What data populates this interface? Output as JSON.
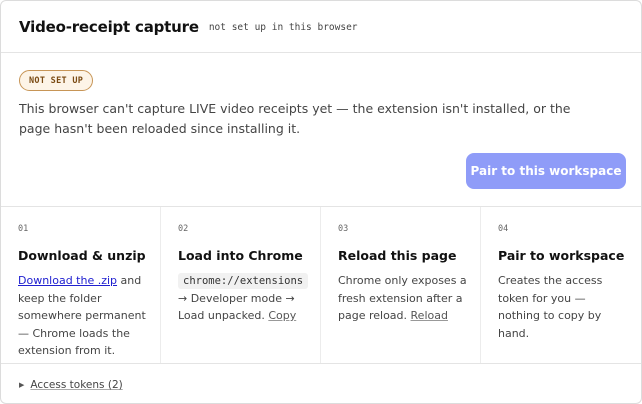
{
  "header": {
    "title": "Video-receipt capture",
    "subtitle": "not set up in this browser"
  },
  "status": {
    "badge": "NOT SET UP",
    "message": "This browser can't capture LIVE video receipts yet — the extension isn't installed, or the page hasn't been reloaded since installing it.",
    "pair_button": "Pair to this workspace",
    "pair_button_color": "#8f9cf8"
  },
  "steps": [
    {
      "num": "01",
      "title": "Download & unzip",
      "link": "Download the .zip",
      "body": " and keep the folder somewhere permanent — Chrome loads the extension from it."
    },
    {
      "num": "02",
      "title": "Load into Chrome",
      "code": "chrome://extensions",
      "body": "→ Developer mode → Load unpacked.",
      "action": "Copy"
    },
    {
      "num": "03",
      "title": "Reload this page",
      "body": "Chrome only exposes a fresh extension after a page reload.",
      "action": "Reload"
    },
    {
      "num": "04",
      "title": "Pair to workspace",
      "body": "Creates the access token for you — nothing to copy by hand."
    }
  ],
  "footer": {
    "label": "Access tokens (2)",
    "icon": "caret-right-icon"
  }
}
